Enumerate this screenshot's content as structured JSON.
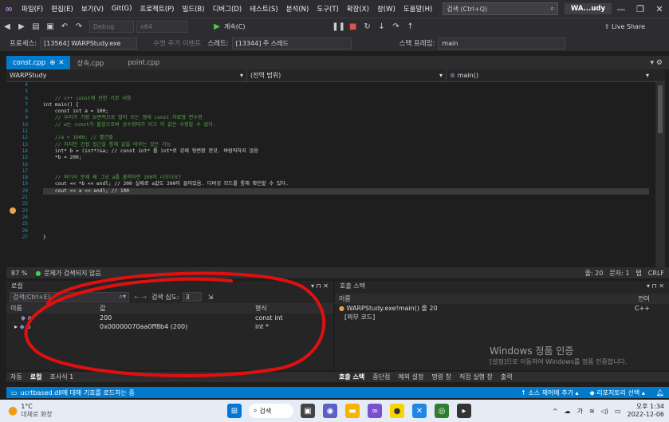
{
  "menubar": {
    "items": [
      "파일(F)",
      "편집(E)",
      "보기(V)",
      "Git(G)",
      "프로젝트(P)",
      "빌드(B)",
      "디버그(D)",
      "테스트(S)",
      "분석(N)",
      "도구(T)",
      "확장(X)",
      "창(W)",
      "도움말(H)"
    ],
    "search_placeholder": "검색 (Ctrl+Q)",
    "solution_name": "WA...udy"
  },
  "toolbar": {
    "config": "Debug",
    "platform": "x64",
    "continue_label": "계속(C)",
    "live_share": "Live Share"
  },
  "procbar": {
    "process_label": "프로세스:",
    "process_value": "[13564] WARPStudy.exe",
    "lifecycle_label": "수명 주기 이벤트",
    "thread_label": "스레드:",
    "thread_value": "[13344] 주 스레드",
    "frame_label": "스택 프레임:",
    "frame_value": "main"
  },
  "tabs": [
    "const.cpp",
    "상속.cpp",
    "point.cpp"
  ],
  "navbar": {
    "project": "WARPStudy",
    "scope": "(전역 범위)",
    "function": "main()"
  },
  "editor": {
    "line_numbers": [
      "4",
      "5",
      "6",
      "7",
      "8",
      "9",
      "10",
      "11",
      "12",
      "13",
      "14",
      "15",
      "16",
      "17",
      "18",
      "19",
      "20",
      "21",
      "22",
      "23",
      "24",
      "25",
      "26",
      "27"
    ],
    "code": [
      "",
      "",
      "    // c++ const에 관한 기본 내용",
      "int main() {",
      "    const int a = 100;",
      "    // 우리가 가장 보편적으로 많이 쓰는 형태 const 자료형 변수명",
      "    // a는 const가 붙음으로써 상수형태가 되고 이 값은 수정할 수 없다.",
      "",
      "    //a = 1000; // 빨간줄",
      "    // 하지만 간접 접근을 통해 값을 바꾸는 것은 가능",
      "    int* b = (int*)&a; // const int* 를 int*로 강제 형변환 한것. 바람직하지 않음",
      "    *b = 200;",
      "",
      "",
      "    // 여기서 문제 왜 그냥 a를 출력하면 100이 나오나요?",
      "    cout << *b << endl; // 200 실제로 a값도 200이 들어있음. 디버깅 모드를 통해 확인할 수 있다.",
      "    cout << a << endl; // 100",
      "",
      "",
      "",
      "",
      "",
      "",
      "}"
    ]
  },
  "edstatus": {
    "zoom": "87 %",
    "issues": "문제가 검색되지 않음",
    "line": "줄: 20",
    "char": "문자: 1",
    "tab": "탭",
    "eol": "CRLF"
  },
  "locals": {
    "title": "로컬",
    "search_placeholder": "검색(Ctrl+E)",
    "depth_label": "검색 심도:",
    "depth_value": "3",
    "columns": [
      "이름",
      "값",
      "형식"
    ],
    "rows": [
      {
        "name": "a",
        "value": "200",
        "type": "const int"
      },
      {
        "name": "b",
        "value": "0x00000070aa0ff8b4 (200)",
        "type": "int *"
      }
    ]
  },
  "callstack": {
    "title": "호출 스택",
    "columns": [
      "이름",
      "언어"
    ],
    "rows": [
      {
        "name": "WARPStudy.exe!main() 줄 20",
        "lang": "C++"
      },
      {
        "name": "[외부 코드]",
        "lang": ""
      }
    ]
  },
  "bottom_tabs_left": [
    "자동",
    "로컬",
    "조사식 1"
  ],
  "bottom_tabs_right": [
    "호출 스택",
    "중단점",
    "예외 설정",
    "명령 창",
    "직접 실행 창",
    "출력"
  ],
  "statusbar": {
    "message": "ucrtbased.dll에 대해 기호를 로드하는 중",
    "source_control": "소스 제어에 추가",
    "repo": "리포지토리 선택"
  },
  "watermark": {
    "title": "Windows 정품 인증",
    "subtitle": "[설정]으로 이동하여 Windows를 정품 인증합니다."
  },
  "taskbar": {
    "weather_temp": "1°C",
    "weather_desc": "대체로 화창",
    "search_label": "검색",
    "ime": "가",
    "time": "오후 1:34",
    "date": "2022-12-06"
  },
  "colors": {
    "accent": "#007acc",
    "annotation": "#e01010"
  }
}
